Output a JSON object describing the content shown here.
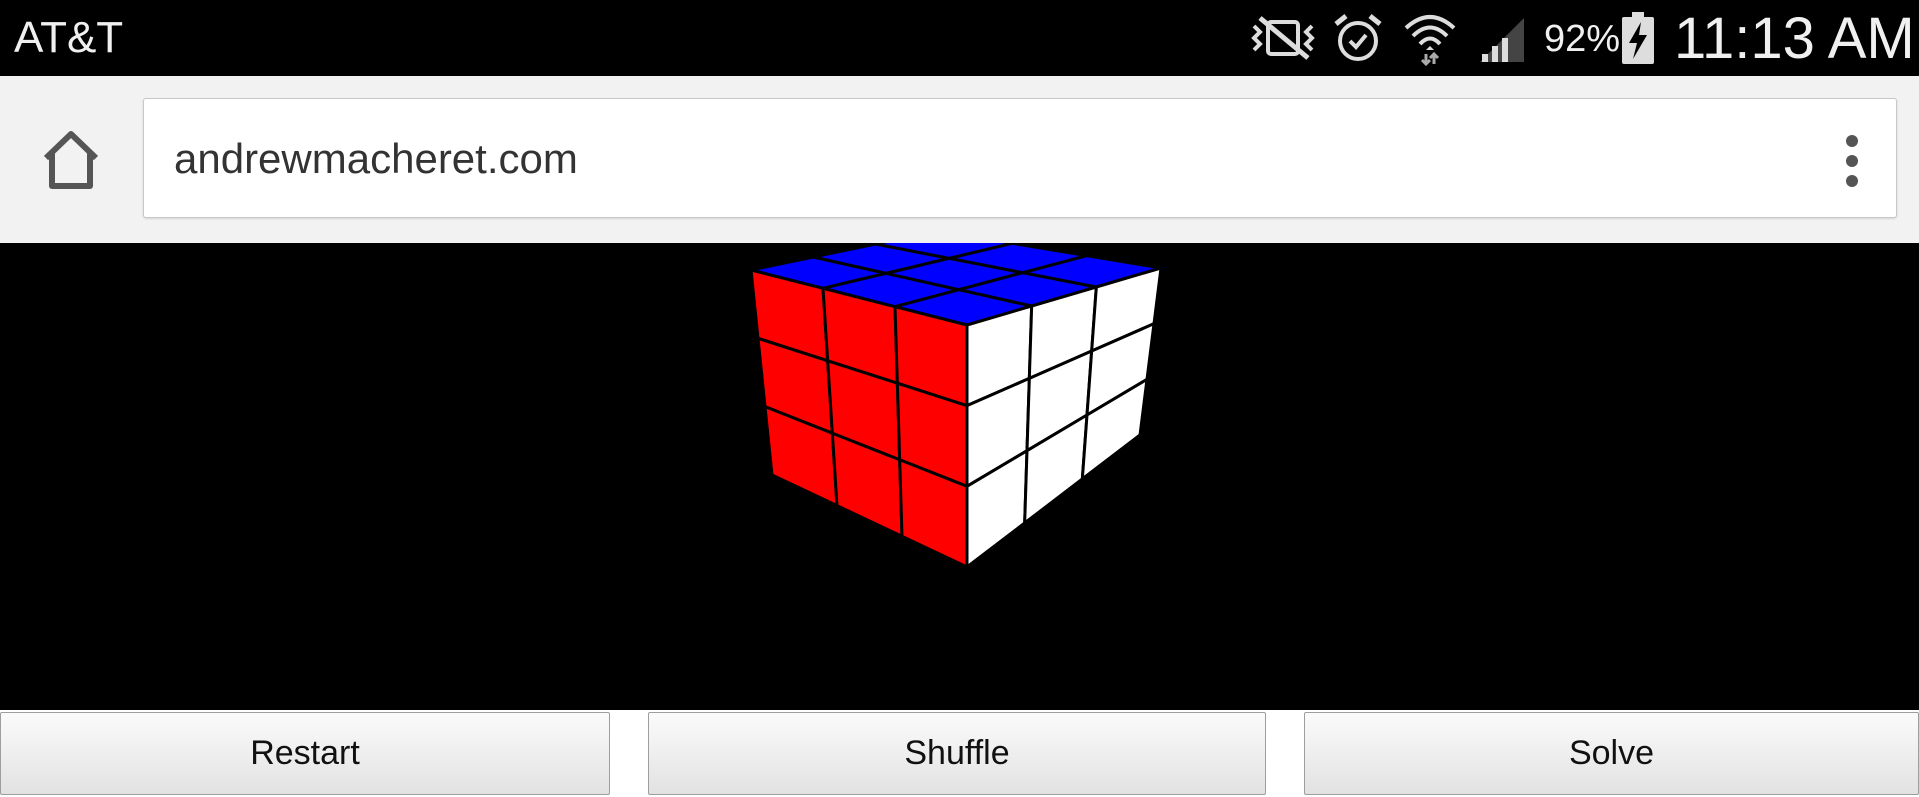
{
  "status_bar": {
    "carrier": "AT&T",
    "battery_percent": "92%",
    "time": "11:13 AM",
    "icons": [
      "vibrate-mute-icon",
      "alarm-icon",
      "wifi-icon",
      "signal-icon",
      "battery-charging-icon"
    ]
  },
  "browser": {
    "url": "andrewmacheret.com",
    "icons": [
      "home-icon",
      "overflow-menu-icon"
    ]
  },
  "cube": {
    "top_color": "#0000ff",
    "left_color": "#ff0000",
    "right_color": "#ffffff",
    "sticker_border_color": "#000000"
  },
  "controls": {
    "restart_label": "Restart",
    "shuffle_label": "Shuffle",
    "solve_label": "Solve"
  }
}
